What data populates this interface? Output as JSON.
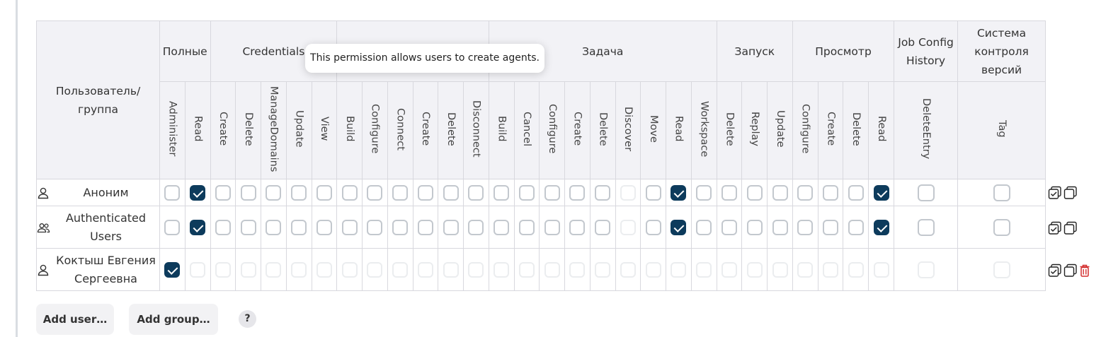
{
  "header": {
    "user_group_label": "Пользователь/\nгруппа",
    "groups": [
      {
        "label": "Полные",
        "span": 2
      },
      {
        "label": "Credentials",
        "span": 5
      },
      {
        "label": "",
        "span": 6
      },
      {
        "label": "Задача",
        "span": 9
      },
      {
        "label": "Запуск",
        "span": 3
      },
      {
        "label": "Просмотр",
        "span": 4
      },
      {
        "label": "Job Config History",
        "span": 1
      },
      {
        "label": "Система контроля версий",
        "span": 1
      }
    ],
    "permissions": [
      "Administer",
      "Read",
      "Create",
      "Delete",
      "ManageDomains",
      "Update",
      "View",
      "Build",
      "Configure",
      "Connect",
      "Create",
      "Delete",
      "Disconnect",
      "Build",
      "Cancel",
      "Configure",
      "Create",
      "Delete",
      "Discover",
      "Move",
      "Read",
      "Workspace",
      "Delete",
      "Replay",
      "Update",
      "Configure",
      "Create",
      "Delete",
      "Read",
      "DeleteEntry",
      "Tag"
    ]
  },
  "tooltip": "This permission allows users to create agents.",
  "rows": [
    {
      "name": "Аноним",
      "icon": "user-icon",
      "checked": [
        1,
        20,
        28
      ],
      "disabled": [
        18
      ],
      "all_disabled_except": null,
      "tools": [
        "select-all-icon",
        "unselect-all-icon"
      ]
    },
    {
      "name": "Authenticated Users",
      "icon": "users-icon",
      "checked": [
        1,
        20,
        28
      ],
      "disabled": [
        18
      ],
      "all_disabled_except": null,
      "tools": [
        "select-all-icon",
        "unselect-all-icon"
      ]
    },
    {
      "name": "Коктыш Евгения Сергеевна",
      "icon": "user-icon",
      "checked": [
        0
      ],
      "disabled": [],
      "all_disabled_except": 0,
      "tools": [
        "select-all-icon",
        "unselect-all-icon",
        "trash-icon"
      ]
    }
  ],
  "buttons": {
    "add_user": "Add user…",
    "add_group": "Add group…",
    "help": "?"
  },
  "colors": {
    "checked": "#0d3b5c",
    "header_bg": "#f2f2f6",
    "delete": "#d32f2f"
  }
}
